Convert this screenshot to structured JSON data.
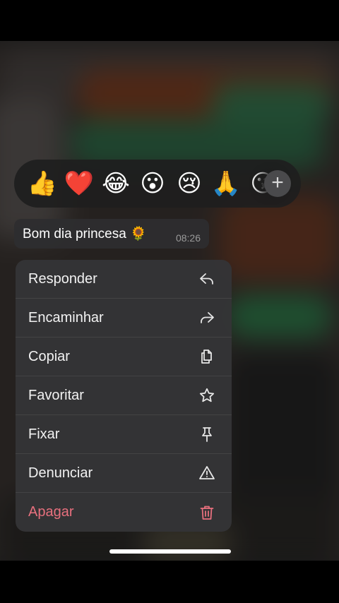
{
  "reactions": {
    "emojis": [
      "👍",
      "❤️",
      "😂",
      "😮",
      "😢",
      "🙏",
      "😘"
    ],
    "add_label": "+"
  },
  "message": {
    "text": "Bom dia princesa 🌻",
    "time": "08:26"
  },
  "menu": {
    "items": [
      {
        "label": "Responder",
        "icon": "reply-icon"
      },
      {
        "label": "Encaminhar",
        "icon": "forward-icon"
      },
      {
        "label": "Copiar",
        "icon": "copy-icon"
      },
      {
        "label": "Favoritar",
        "icon": "star-icon"
      },
      {
        "label": "Fixar",
        "icon": "pin-icon"
      },
      {
        "label": "Denunciar",
        "icon": "warning-icon"
      },
      {
        "label": "Apagar",
        "icon": "trash-icon",
        "destructive": true
      }
    ]
  },
  "colors": {
    "destructive": "#e8707e",
    "menu_bg": "#343436",
    "background_accent": "#2f7a4a"
  }
}
